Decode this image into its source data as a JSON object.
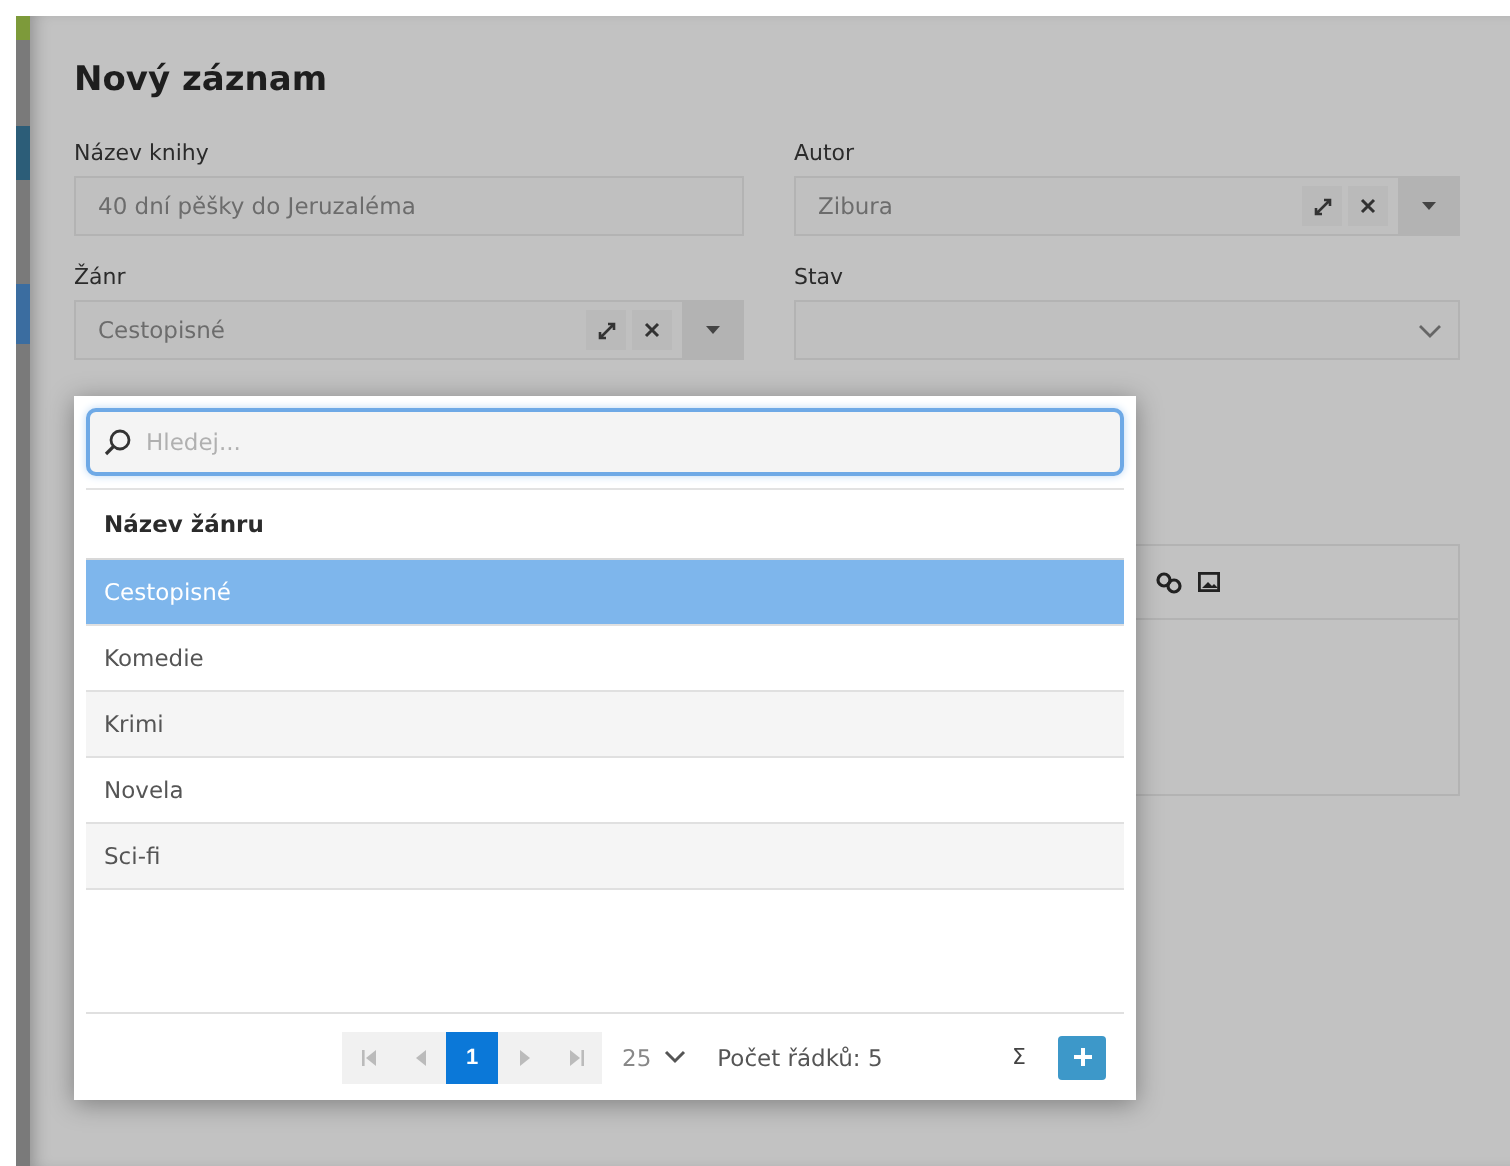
{
  "dialog": {
    "title": "Nový záznam"
  },
  "fields": [
    {
      "label": "Název knihy",
      "kind": "text",
      "value": "40 dní pěšky do Jeruzaléma"
    },
    {
      "label": "Autor",
      "kind": "lookup",
      "value": "Zibura"
    },
    {
      "label": "Žánr",
      "kind": "lookup",
      "value": "Cestopisné"
    },
    {
      "label": "Stav",
      "kind": "select"
    }
  ],
  "dropdown": {
    "search": {
      "placeholder": "Hledej..."
    },
    "column": "Název žánru",
    "rows": [
      {
        "text": "Cestopisné",
        "selected": true
      },
      {
        "text": "Komedie",
        "selected": false
      },
      {
        "text": "Krimi",
        "selected": false
      },
      {
        "text": "Novela",
        "selected": false
      },
      {
        "text": "Sci-fi",
        "selected": false
      }
    ],
    "pager": {
      "page": "1",
      "page_size": "25",
      "row_count": "Počet řádků: 5",
      "sum": "Σ"
    }
  }
}
